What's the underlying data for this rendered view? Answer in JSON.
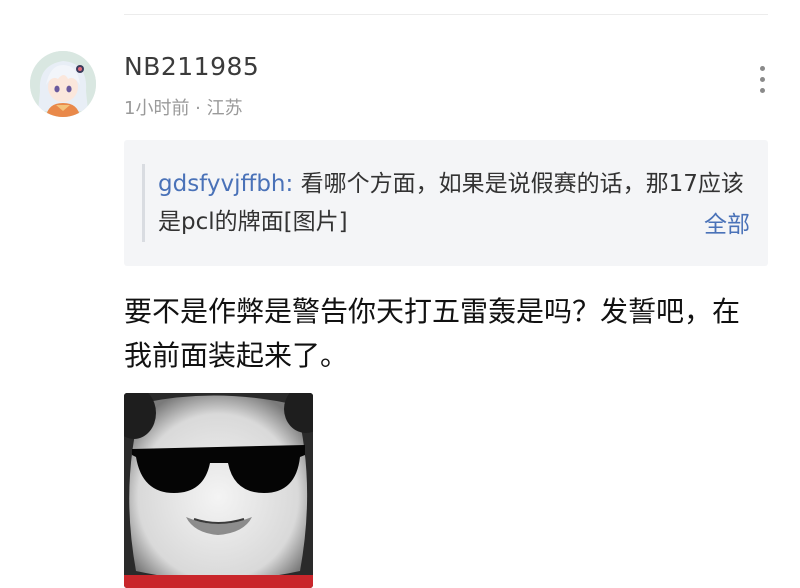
{
  "divider": true,
  "comment": {
    "username": "NB211985",
    "time": "1小时前",
    "separator": " · ",
    "location": "江苏",
    "body": "要不是作弊是警告你天打五雷轰是吗？发誓吧，在我前面装起来了。",
    "more_icon": "vertical-dots-icon",
    "avatar_icon": "anime-avatar"
  },
  "quote": {
    "author": "gdsfyvjffbh",
    "colon": ": ",
    "text": "看哪个方面，如果是说假赛的话，那17应该是pcl的牌面[图片]",
    "expand_label": "全部"
  },
  "image": {
    "icon": "sunglasses-meme-face"
  },
  "colors": {
    "link": "#4a72b8",
    "quote_bg": "#f4f5f7",
    "meta": "#9a9a9a"
  }
}
